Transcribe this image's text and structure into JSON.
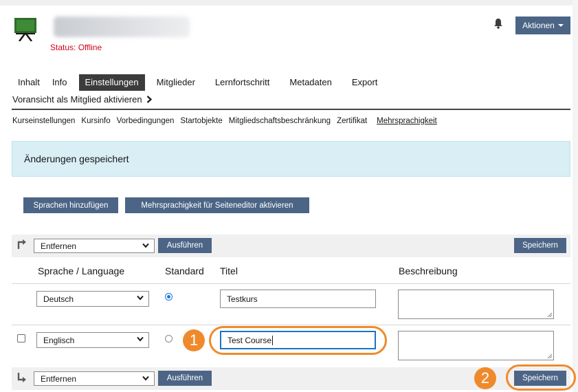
{
  "header": {
    "status_text": "Status: Offline",
    "actions_label": "Aktionen"
  },
  "tabs": [
    {
      "label": "Inhalt"
    },
    {
      "label": "Info"
    },
    {
      "label": "Einstellungen",
      "active": true
    },
    {
      "label": "Mitglieder"
    },
    {
      "label": "Lernfortschritt"
    },
    {
      "label": "Metadaten"
    },
    {
      "label": "Export"
    }
  ],
  "preview_link": "Voransicht als Mitglied aktivieren",
  "subtabs": [
    {
      "label": "Kurseinstellungen"
    },
    {
      "label": "Kursinfo"
    },
    {
      "label": "Vorbedingungen"
    },
    {
      "label": "Startobjekte"
    },
    {
      "label": "Mitgliedschaftsbeschränkung"
    },
    {
      "label": "Zertifikat"
    },
    {
      "label": "Mehrsprachigkeit",
      "active": true
    }
  ],
  "message": "Änderungen gespeichert",
  "buttons": {
    "add_languages": "Sprachen hinzufügen",
    "activate_multilang": "Mehrsprachigkeit für Seiteneditor aktivieren",
    "execute": "Ausführen",
    "save": "Speichern"
  },
  "bulk_action": {
    "selected": "Entfernen"
  },
  "table": {
    "columns": [
      "Sprache / Language",
      "Standard",
      "Titel",
      "Beschreibung"
    ],
    "rows": [
      {
        "language": "Deutsch",
        "standard": true,
        "title": "Testkurs",
        "description": "",
        "checkbox": false
      },
      {
        "language": "Englisch",
        "standard": false,
        "title": "Test Course",
        "description": "",
        "checkbox": true
      }
    ]
  },
  "callouts": [
    "1",
    "2"
  ],
  "colors": {
    "primary_button": "#4c6586",
    "callout": "#ef8a2c",
    "status": "#d0021b",
    "info_bg": "#d9eef5"
  }
}
